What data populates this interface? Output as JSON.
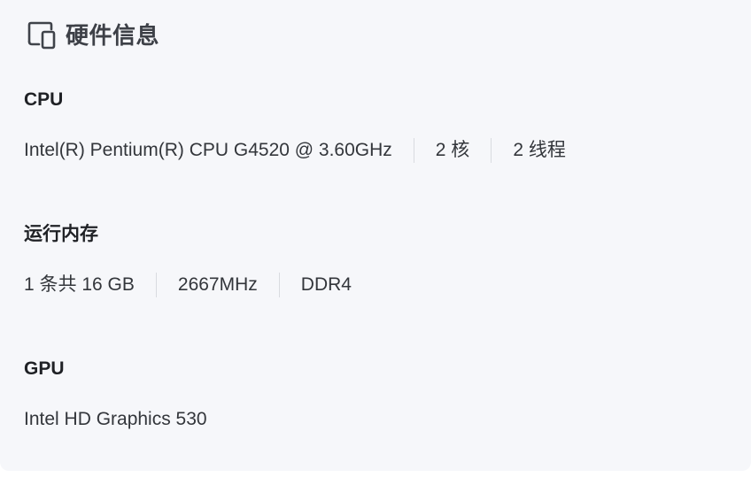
{
  "header": {
    "title": "硬件信息",
    "icon": "devices-icon"
  },
  "cpu": {
    "title": "CPU",
    "specs": [
      "Intel(R) Pentium(R) CPU G4520 @ 3.60GHz",
      "2 核",
      "2 线程"
    ]
  },
  "ram": {
    "title": "运行内存",
    "specs": [
      "1 条共 16 GB",
      "2667MHz",
      "DDR4"
    ]
  },
  "gpu": {
    "title": "GPU",
    "specs": [
      "Intel HD Graphics 530"
    ]
  },
  "colors": {
    "card_background": "#f6f7fa",
    "divider": "#d9dbe0",
    "title_text": "#1f2125",
    "body_text": "#33363b"
  }
}
